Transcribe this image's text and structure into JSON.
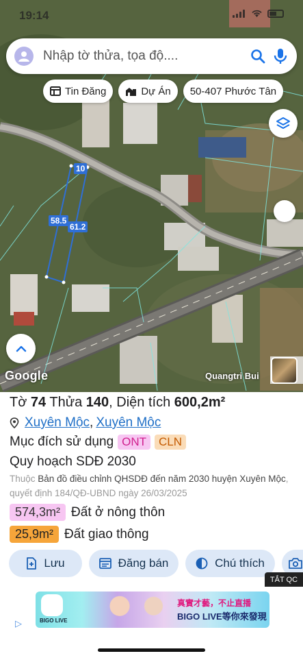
{
  "status": {
    "time": "19:14"
  },
  "search": {
    "placeholder": "Nhập tờ thửa, tọa độ...."
  },
  "chips": [
    {
      "label": "Tin Đăng",
      "icon": "news-icon"
    },
    {
      "label": "Dự Án",
      "icon": "buildings-icon"
    },
    {
      "label": "50-407 Phước Tân",
      "icon": ""
    }
  ],
  "map": {
    "edge_labels": [
      "10",
      "58.5",
      "61.2"
    ],
    "attribution": "Google",
    "author": "Quangtri Bui"
  },
  "parcel": {
    "sheet_label": "Tờ",
    "sheet": "74",
    "parcel_label": "Thửa",
    "parcel": "140",
    "area_label": "Diện tích",
    "area": "600,2m²",
    "location": [
      "Xuyên Mộc",
      "Xuyên Mộc"
    ],
    "purpose_label": "Mục đích sử dụng",
    "purpose_tags": [
      "ONT",
      "CLN"
    ],
    "plan_title": "Quy hoạch SDĐ 2030",
    "plan_prefix": "Thuộc",
    "plan_name": "Bản đồ điều chỉnh QHSDĐ đến năm 2030 huyện Xuyên Mộc",
    "plan_decision": ", quyết định 184/QĐ-UBND ngày 26/03/2025",
    "areas": [
      {
        "value": "574,3m²",
        "label": "Đất ở nông thôn",
        "color": "#f7c6f2"
      },
      {
        "value": "25,9m²",
        "label": "Đất giao thông",
        "color": "#f6a53a"
      }
    ]
  },
  "actions": [
    {
      "label": "Lưu",
      "icon": "save-icon"
    },
    {
      "label": "Đăng bán",
      "icon": "listing-icon"
    },
    {
      "label": "Chú thích",
      "icon": "legend-icon"
    },
    {
      "label": "",
      "icon": "camera-icon"
    }
  ],
  "ad": {
    "close_label": "TẮT QC",
    "brand": "BIGO LIVE",
    "text1": "真實才藝，不止直播",
    "text2": "BIGO LIVE等你來發現"
  },
  "colors": {
    "accent": "#1f6fc7",
    "parcel_outline": "#2f6fd6",
    "button_bg": "#dde8f7"
  }
}
